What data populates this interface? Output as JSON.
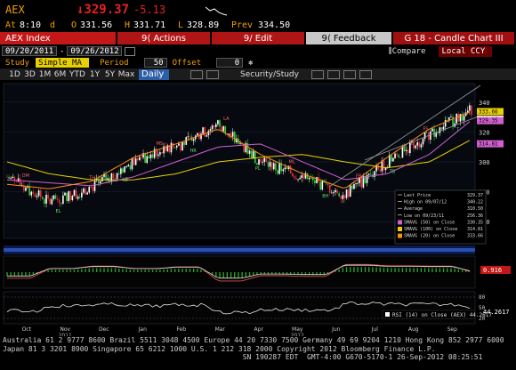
{
  "header": {
    "symbol": "AEX",
    "last_price": "↓329.37",
    "change": "-5.13",
    "time_label": "At",
    "time": "8:10",
    "flag": "d",
    "open_label": "O",
    "open": "331.56",
    "high_label": "H",
    "high": "331.71",
    "low_label": "L",
    "low": "328.89",
    "prev_label": "Prev",
    "prev": "334.50"
  },
  "menu": {
    "title": "AEX Index",
    "actions": "9⟨ Actions",
    "edit": "9/ Edit",
    "feedback": "9⟨ Feedback",
    "name": "G 18 - Candle Chart III"
  },
  "controls": {
    "start_date": "09/20/2011",
    "end_date": "09/26/2012",
    "compare": "Compare",
    "currency": "Local CCY",
    "study_label": "Study",
    "study": "Simple MA",
    "period_label": "Period",
    "period": "50",
    "offset_label": "Offset",
    "offset": "0",
    "periods": [
      "1D",
      "3D",
      "1M",
      "6M",
      "YTD",
      "1Y",
      "5Y",
      "Max"
    ],
    "daily": "Daily",
    "security_study": "Security/Study"
  },
  "chart_data": {
    "type": "line",
    "x": [
      "Oct",
      "Nov",
      "Dec",
      "Jan",
      "Feb",
      "Mar",
      "Apr",
      "May",
      "Jun",
      "Jul",
      "Aug",
      "Sep"
    ],
    "year_labels": [
      "2011",
      "2012"
    ],
    "series": [
      {
        "name": "Last Price",
        "values": [
          290,
          273,
          283,
          300,
          310,
          325,
          300,
          290,
          278,
          300,
          318,
          335
        ]
      },
      {
        "name": "SMAVG (50) on Close",
        "values": [
          288,
          286,
          284,
          290,
          300,
          310,
          312,
          300,
          288,
          292,
          305,
          328
        ]
      },
      {
        "name": "SMAVG (100) on Close",
        "values": [
          300,
          292,
          288,
          288,
          292,
          300,
          303,
          305,
          300,
          296,
          300,
          315
        ]
      },
      {
        "name": "SMAVG (20) on Close",
        "values": [
          285,
          282,
          287,
          303,
          312,
          322,
          305,
          292,
          282,
          303,
          322,
          334
        ]
      }
    ],
    "ylim": [
      250,
      350
    ],
    "yticks": [
      260,
      280,
      300,
      320,
      340
    ],
    "price_tags": [
      "333.66",
      "329.37",
      "329.35",
      "314.81"
    ],
    "legend": {
      "title": "Last Price",
      "rows": [
        {
          "label": "Last Price",
          "value": "329.37"
        },
        {
          "label": "High on 09/07/12",
          "value": "340.22"
        },
        {
          "label": "Average",
          "value": "310.50"
        },
        {
          "label": "Low on 09/23/11",
          "value": "256.36"
        },
        {
          "label": "SMAVG (50) on Close",
          "value": "330.35"
        },
        {
          "label": "SMAVG (100) on Close",
          "value": "314.81"
        },
        {
          "label": "SMAVG (20) on Close",
          "value": "333.66"
        }
      ]
    },
    "annotations": [
      "DM",
      "EL",
      "TH",
      "LE",
      "MS",
      "HR",
      "LA",
      "PL",
      "ML",
      "BH",
      "FB",
      "TB",
      "FS",
      "T"
    ],
    "macd_value": "0.916",
    "rsi_label": "RSI (14) on Close (AEX) 44.2617",
    "rsi_value": "44.2617",
    "rsi_ticks": [
      "80",
      "50",
      "20"
    ],
    "legend_colors": {
      "last": "#ffffff",
      "sma50": "#d060d0",
      "sma100": "#e8d000",
      "sma20": "#ff8c1a"
    }
  },
  "footer": {
    "line1": "Australia 61 2 9777 8600 Brazil 5511 3048 4500 Europe 44 20 7330 7500 Germany 49 69 9204 1210 Hong Kong 852 2977 6000",
    "line2": "Japan 81 3 3201 8900         Singapore 65 6212 1000       U.S. 1 212 318 2000          Copyright 2012 Bloomberg Finance L.P.",
    "line3": "                                                        SN 190287 EDT  GMT-4:00 G670-5170-1 26-Sep-2012 08:25:51"
  },
  "colors": {
    "amber": "#f0a000",
    "red": "#e82020",
    "blue_bar": "#2c5fa8"
  }
}
